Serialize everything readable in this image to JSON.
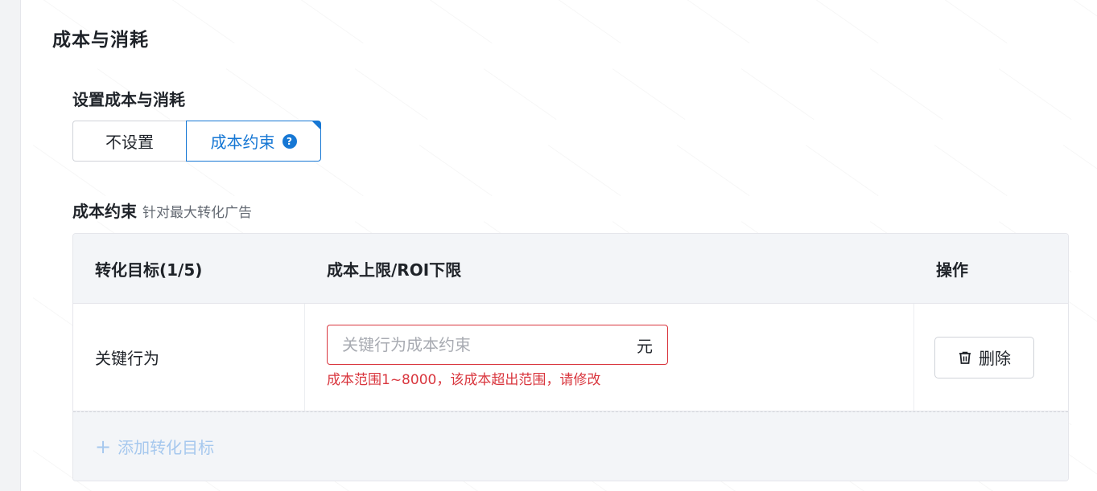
{
  "section": {
    "title": "成本与消耗"
  },
  "setting": {
    "label": "设置成本与消耗",
    "options": [
      {
        "label": "不设置",
        "selected": false
      },
      {
        "label": "成本约束",
        "selected": true
      }
    ],
    "help_icon": "?"
  },
  "constraint": {
    "title": "成本约束",
    "hint": "针对最大转化广告"
  },
  "table": {
    "columns": [
      "转化目标(1/5)",
      "成本上限/ROI下限",
      "操作"
    ],
    "rows": [
      {
        "goal": "关键行为",
        "input_value": "",
        "input_placeholder": "关键行为成本约束",
        "unit": "元",
        "error": "成本范围1~8000，该成本超出范围，请修改",
        "action_label": "删除"
      }
    ],
    "add_label": "添加转化目标"
  },
  "colors": {
    "primary": "#1677d4",
    "error": "#d9363e",
    "add_disabled": "#a6c8ee"
  }
}
